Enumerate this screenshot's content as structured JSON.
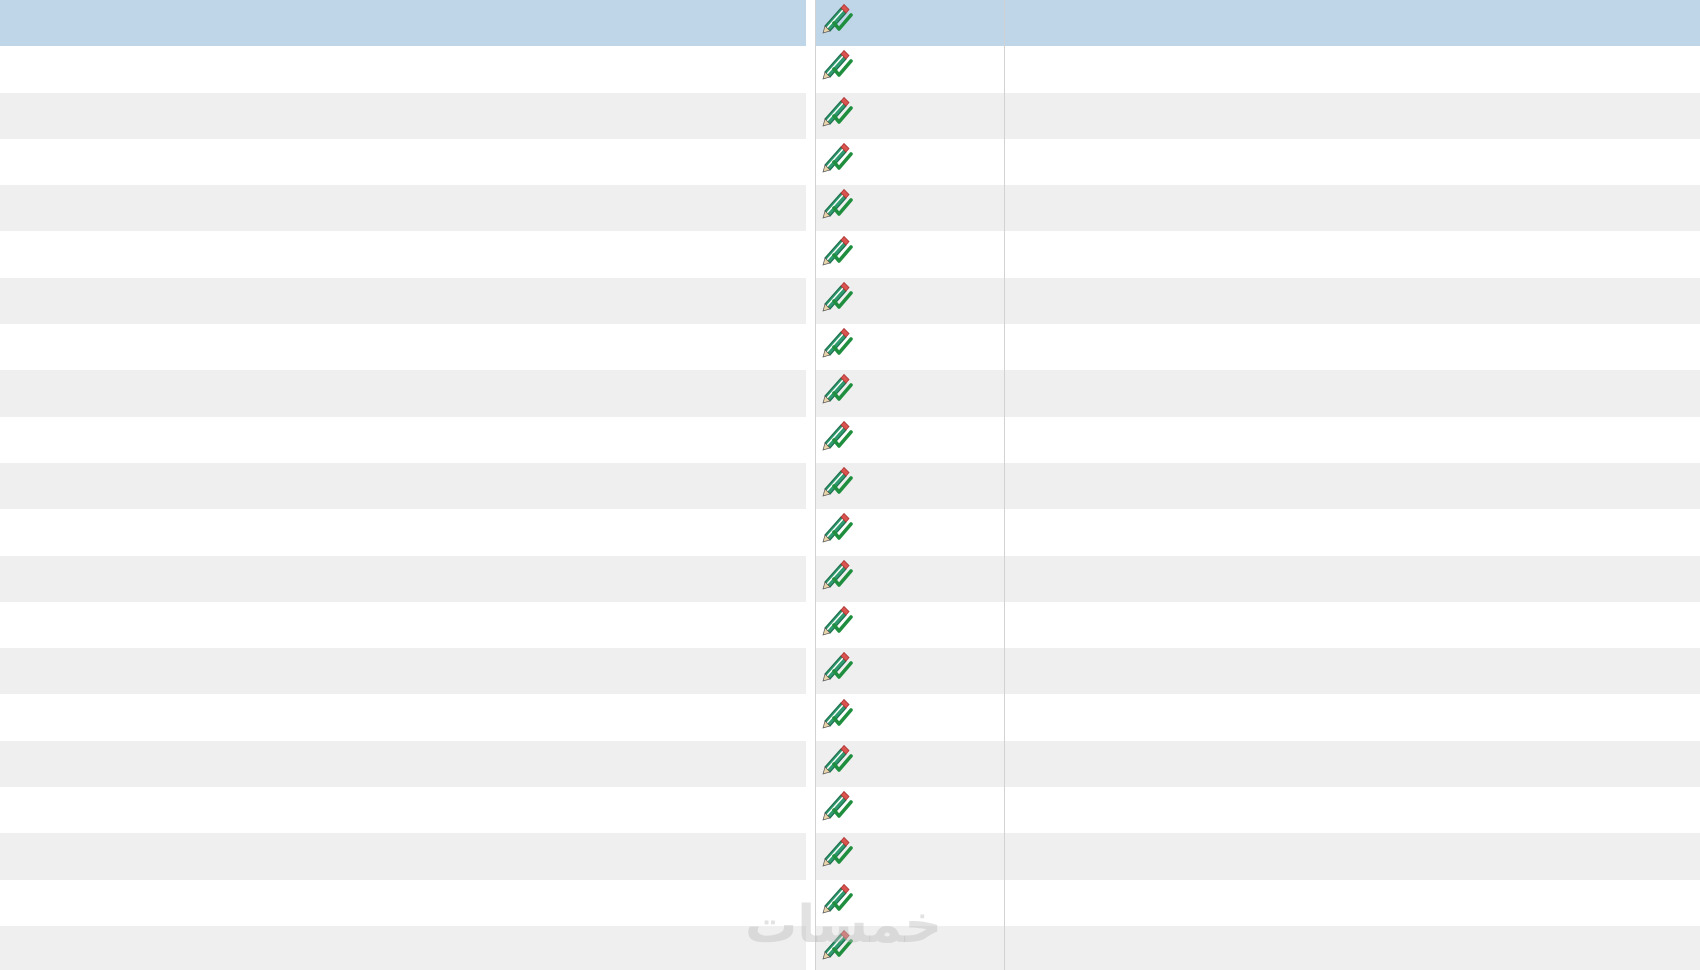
{
  "table": {
    "row_count": 21,
    "selected_row": 0,
    "row_icon": "edit-approve-icon",
    "colors": {
      "selected_row": "#bfd6e8",
      "alt_row": "#efefef",
      "row": "#ffffff",
      "grid_line": "#d2d2d2",
      "pencil": "#2e9a6e",
      "check": "#1f8f3f",
      "eraser": "#d9534f"
    }
  },
  "watermark": {
    "text": "خمسات"
  }
}
